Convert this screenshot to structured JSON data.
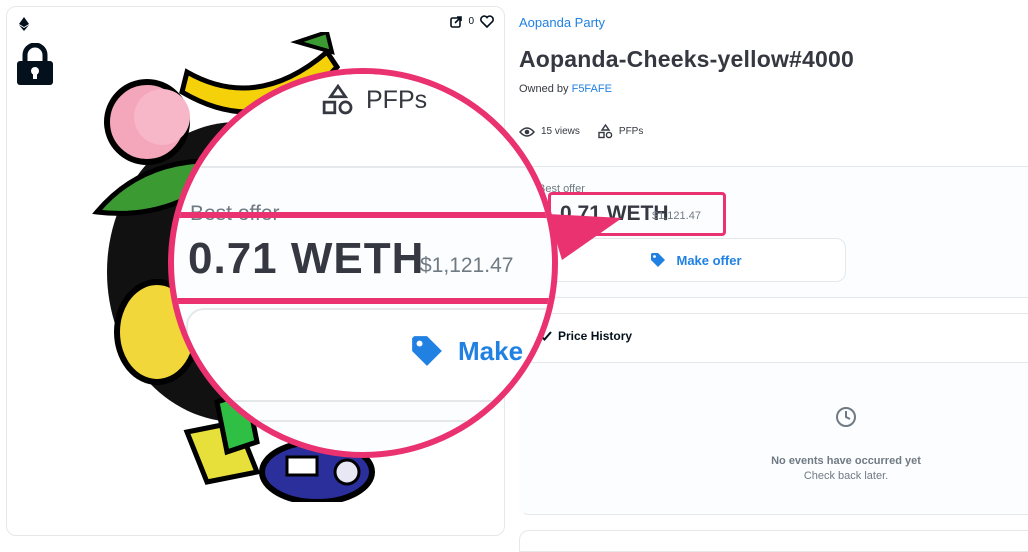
{
  "nft": {
    "collection": "Aopanda Party",
    "title": "Aopanda-Cheeks-yellow#4000",
    "owned_by_prefix": "Owned by",
    "owner": "F5FAFE",
    "favorites_count": "0"
  },
  "stats": {
    "views": "15 views",
    "category": "PFPs"
  },
  "offer": {
    "label": "Best offer",
    "price": "0.71 WETH",
    "usd": "$1,121.47",
    "button_label": "Make offer"
  },
  "price_history": {
    "title": "Price History",
    "empty_title": "No events have occurred yet",
    "empty_sub": "Check back later."
  },
  "magnifier": {
    "stat_prev": "s",
    "stat_label": "PFPs",
    "best_offer": "Best offer",
    "price": "0.71 WETH",
    "usd": "$1,121.47",
    "button_partial": "Make o"
  },
  "colors": {
    "accent": "#2081e2",
    "highlight": "#e9326f",
    "text": "#353840",
    "muted": "#707a83"
  },
  "icons": [
    "ethereum-icon",
    "lock-icon",
    "external-link-icon",
    "heart-icon",
    "eye-icon",
    "shapes-icon",
    "tag-icon",
    "chevron-icon",
    "clock-icon"
  ]
}
